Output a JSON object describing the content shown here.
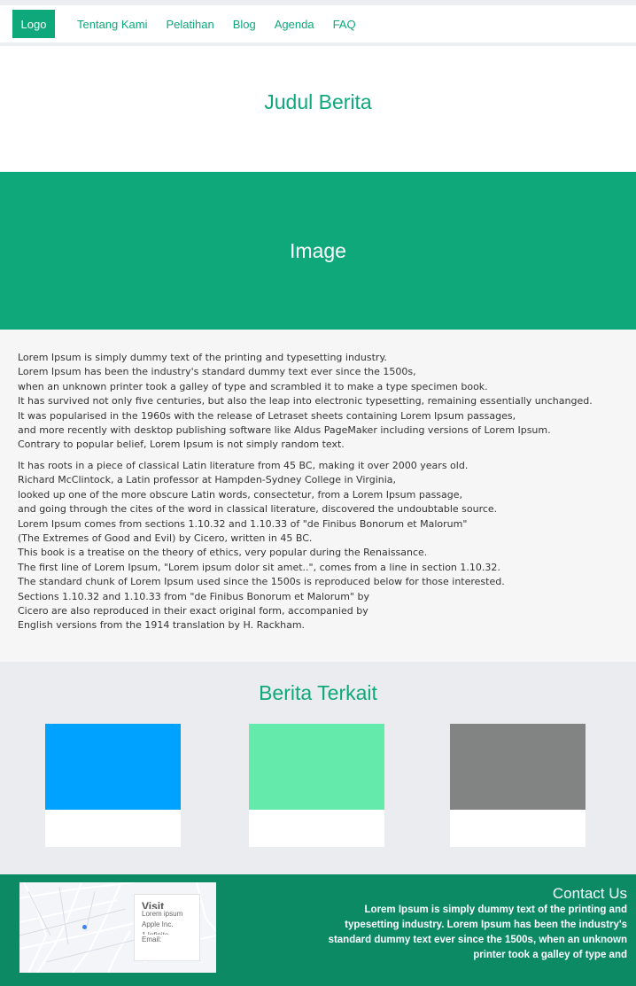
{
  "nav": {
    "logo": "Logo",
    "links": [
      "Tentang Kami",
      "Pelatihan",
      "Blog",
      "Agenda",
      "FAQ"
    ]
  },
  "page_title": "Judul Berita",
  "hero_label": "Image",
  "article": {
    "para1": [
      "Lorem Ipsum is simply dummy text of the printing and typesetting industry.",
      "Lorem Ipsum has been the industry's standard dummy text ever since the 1500s,",
      "when an unknown printer took a galley of type and scrambled it to make a type specimen book.",
      "It has survived not only five centuries, but also the leap into electronic typesetting, remaining essentially unchanged.",
      "It was popularised in the 1960s with the release of Letraset sheets containing Lorem Ipsum passages,",
      "and more recently with desktop publishing software like Aldus PageMaker including versions of Lorem Ipsum.",
      "Contrary to popular belief, Lorem Ipsum is not simply random text."
    ],
    "para2": [
      "It has roots in a piece of classical Latin literature from 45 BC, making it over 2000 years old.",
      "Richard McClintock, a Latin professor at Hampden-Sydney College in Virginia,",
      "looked up one of the more obscure Latin words, consectetur, from a Lorem Ipsum passage,",
      "and going through the cites of the word in classical literature, discovered the undoubtable source.",
      "Lorem Ipsum comes from sections 1.10.32 and 1.10.33 of \"de Finibus Bonorum et Malorum\"",
      "(The Extremes of Good and Evil) by Cicero, written in 45 BC.",
      "This book is a treatise on the theory of ethics, very popular during the Renaissance.",
      "The first line of Lorem Ipsum, \"Lorem ipsum dolor sit amet..\", comes from a line in section 1.10.32.",
      "The standard chunk of Lorem Ipsum used since the 1500s is reproduced below for those interested.",
      "Sections 1.10.32 and 1.10.33 from \"de Finibus Bonorum et Malorum\" by",
      "Cicero are also reproduced in their exact original form, accompanied by",
      "English versions from the 1914 translation by H. Rackham."
    ]
  },
  "related": {
    "title": "Berita Terkait",
    "cards": [
      {
        "color": "#00a2ff"
      },
      {
        "color": "#64ebab"
      },
      {
        "color": "#828383"
      }
    ]
  },
  "footer": {
    "map": {
      "card_title": "Visit",
      "lines": [
        "Lorem ipsum",
        "Apple Inc.",
        "1 Infinite",
        "Email:"
      ]
    },
    "contact_title": "Contact Us",
    "contact_text": "Lorem Ipsum is simply dummy text of the printing and typesetting industry. Lorem Ipsum has been the industry's standard dummy text ever since the 1500s, when an unknown printer took a galley of type and"
  },
  "colors": {
    "brand": "#0ea87a",
    "footer": "#0b8a64"
  }
}
